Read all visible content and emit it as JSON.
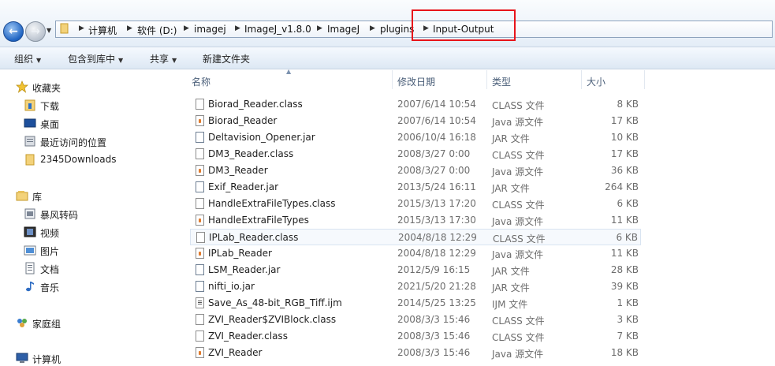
{
  "breadcrumb": {
    "items": [
      "计算机",
      "软件 (D:)",
      "imagej",
      "ImageJ_v1.8.0",
      "ImageJ",
      "plugins",
      "Input-Output"
    ]
  },
  "toolbar": {
    "organize": "组织",
    "include_in_library": "包含到库中",
    "share": "共享",
    "new_folder": "新建文件夹"
  },
  "sidebar": {
    "favorites": "收藏夹",
    "favorites_items": [
      "下载",
      "桌面",
      "最近访问的位置",
      "2345Downloads"
    ],
    "libraries": "库",
    "library_items": [
      "暴风转码",
      "视频",
      "图片",
      "文档",
      "音乐"
    ],
    "homegroup": "家庭组",
    "computer": "计算机"
  },
  "columns": {
    "name": "名称",
    "modified": "修改日期",
    "type": "类型",
    "size": "大小"
  },
  "files": [
    {
      "name": "Biorad_Reader.class",
      "date": "2007/6/14 10:54",
      "type": "CLASS 文件",
      "size": "8 KB",
      "icon": "class"
    },
    {
      "name": "Biorad_Reader",
      "date": "2007/6/14 10:54",
      "type": "Java 源文件",
      "size": "17 KB",
      "icon": "java"
    },
    {
      "name": "Deltavision_Opener.jar",
      "date": "2006/10/4 16:18",
      "type": "JAR 文件",
      "size": "10 KB",
      "icon": "jar"
    },
    {
      "name": "DM3_Reader.class",
      "date": "2008/3/27 0:00",
      "type": "CLASS 文件",
      "size": "17 KB",
      "icon": "class"
    },
    {
      "name": "DM3_Reader",
      "date": "2008/3/27 0:00",
      "type": "Java 源文件",
      "size": "36 KB",
      "icon": "java"
    },
    {
      "name": "Exif_Reader.jar",
      "date": "2013/5/24 16:11",
      "type": "JAR 文件",
      "size": "264 KB",
      "icon": "jar"
    },
    {
      "name": "HandleExtraFileTypes.class",
      "date": "2015/3/13 17:20",
      "type": "CLASS 文件",
      "size": "6 KB",
      "icon": "class"
    },
    {
      "name": "HandleExtraFileTypes",
      "date": "2015/3/13 17:30",
      "type": "Java 源文件",
      "size": "11 KB",
      "icon": "java"
    },
    {
      "name": "IPLab_Reader.class",
      "date": "2004/8/18 12:29",
      "type": "CLASS 文件",
      "size": "6 KB",
      "icon": "class",
      "selected": true
    },
    {
      "name": "IPLab_Reader",
      "date": "2004/8/18 12:29",
      "type": "Java 源文件",
      "size": "11 KB",
      "icon": "java"
    },
    {
      "name": "LSM_Reader.jar",
      "date": "2012/5/9 16:15",
      "type": "JAR 文件",
      "size": "28 KB",
      "icon": "jar"
    },
    {
      "name": "nifti_io.jar",
      "date": "2021/5/20 21:28",
      "type": "JAR 文件",
      "size": "39 KB",
      "icon": "jar"
    },
    {
      "name": "Save_As_48-bit_RGB_Tiff.ijm",
      "date": "2014/5/25 13:25",
      "type": "IJM 文件",
      "size": "1 KB",
      "icon": "ijm"
    },
    {
      "name": "ZVI_Reader$ZVIBlock.class",
      "date": "2008/3/3 15:46",
      "type": "CLASS 文件",
      "size": "3 KB",
      "icon": "class"
    },
    {
      "name": "ZVI_Reader.class",
      "date": "2008/3/3 15:46",
      "type": "CLASS 文件",
      "size": "7 KB",
      "icon": "class"
    },
    {
      "name": "ZVI_Reader",
      "date": "2008/3/3 15:46",
      "type": "Java 源文件",
      "size": "18 KB",
      "icon": "java"
    }
  ],
  "colors": {
    "highlight_box": "#e8141b",
    "selected_row": "#f6f9fd"
  }
}
